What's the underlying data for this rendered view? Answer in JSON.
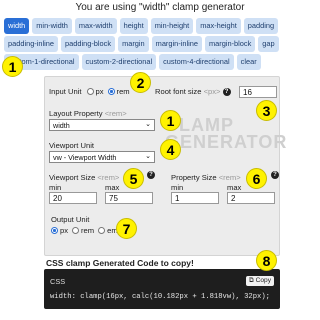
{
  "header": {
    "title": "You are using \"width\" clamp generator"
  },
  "properties": [
    {
      "label": "width",
      "active": true
    },
    {
      "label": "min-width"
    },
    {
      "label": "max-width"
    },
    {
      "label": "height"
    },
    {
      "label": "min-height"
    },
    {
      "label": "max-height"
    },
    {
      "label": "padding"
    },
    {
      "label": "padding-inline"
    },
    {
      "label": "padding-block"
    },
    {
      "label": "margin"
    },
    {
      "label": "margin-inline"
    },
    {
      "label": "margin-block"
    },
    {
      "label": "gap"
    },
    {
      "label": "custom-1-directional"
    },
    {
      "label": "custom-2-directional"
    },
    {
      "label": "custom-4-directional"
    },
    {
      "label": "clear"
    }
  ],
  "form": {
    "input_unit": {
      "label": "Input Unit",
      "options": [
        "px",
        "rem"
      ],
      "selected": "rem"
    },
    "root_font_size": {
      "label": "Root font size",
      "unit": "<px>",
      "value": "16"
    },
    "layout_property": {
      "label": "Layout Property",
      "unit": "<rem>",
      "value": "width"
    },
    "viewport_unit": {
      "label": "Viewport Unit",
      "value": "vw - Viewport Width"
    },
    "viewport_size": {
      "label": "Viewport Size",
      "unit": "<rem>",
      "min_label": "min",
      "max_label": "max",
      "min": "20",
      "max": "75"
    },
    "property_size": {
      "label": "Property Size",
      "unit": "<rem>",
      "min_label": "min",
      "max_label": "max",
      "min": "1",
      "max": "2"
    },
    "output_unit": {
      "label": "Output Unit",
      "options": [
        "px",
        "rem",
        "em"
      ],
      "selected": "px"
    }
  },
  "watermark": {
    "line1": "CLAMP",
    "line2": "GENERATOR"
  },
  "output": {
    "heading": "CSS clamp Generated Code to copy!",
    "lang": "CSS",
    "copy_label": "Copy",
    "code": "width: clamp(16px, calc(10.182px + 1.818vw), 32px);"
  },
  "badges": [
    "1",
    "2",
    "3",
    "1",
    "4",
    "5",
    "6",
    "7",
    "8"
  ],
  "colors": {
    "accent": "#2a6fd6",
    "chip_bg": "#cfe0f5",
    "badge": "#fff200",
    "code_bg": "#1e1e1e"
  }
}
